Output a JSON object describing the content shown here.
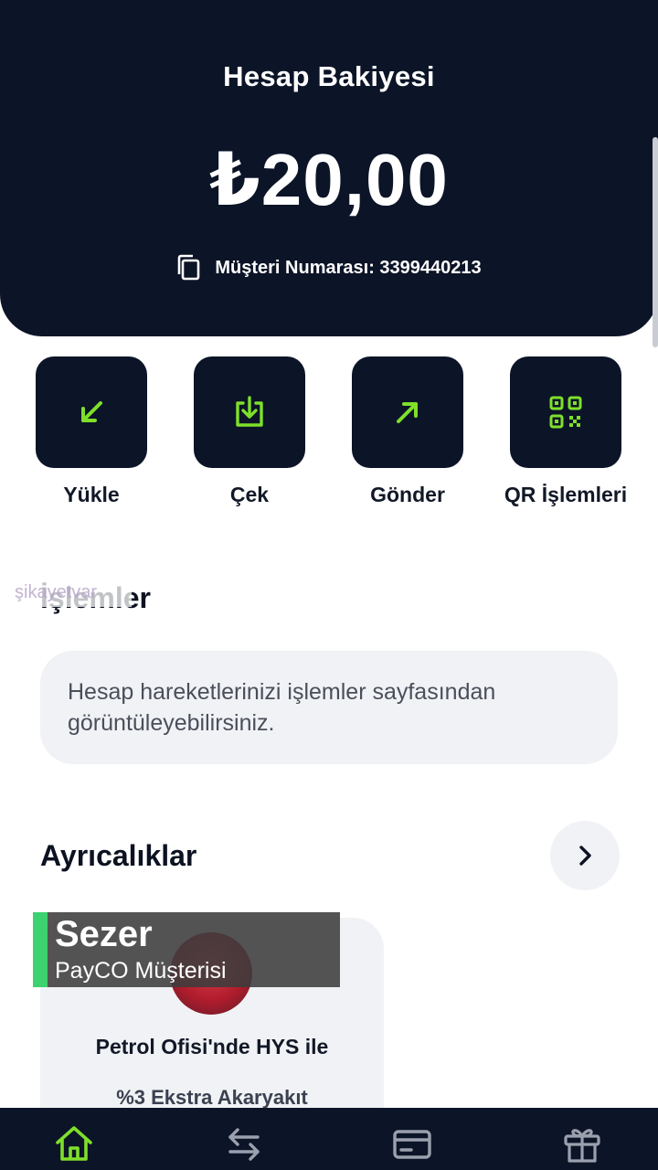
{
  "balance": {
    "title": "Hesap Bakiyesi",
    "amount": "₺20,00",
    "customer_number_label": "Müşteri Numarası: 3399440213"
  },
  "actions": [
    {
      "label": "Yükle",
      "icon": "arrow-down-left-icon"
    },
    {
      "label": "Çek",
      "icon": "download-tray-icon"
    },
    {
      "label": "Gönder",
      "icon": "arrow-up-right-icon"
    },
    {
      "label": "QR İşlemleri",
      "icon": "qr-code-icon"
    }
  ],
  "transactions": {
    "title": "İşlemler",
    "info": "Hesap hareketlerinizi işlemler sayfasından görüntüleyebilirsiniz."
  },
  "watermark": "şikayetvar",
  "privileges": {
    "title": "Ayrıcalıklar",
    "offer_title": "Petrol Ofisi'nde HYS ile",
    "offer_subtitle": "%3 Ekstra Akaryakıt"
  },
  "caption": {
    "name": "Sezer",
    "role": "PayCO Müşterisi"
  },
  "bottom_nav": [
    {
      "icon": "home-icon",
      "active": true
    },
    {
      "icon": "transfer-arrows-icon",
      "active": false
    },
    {
      "icon": "card-icon",
      "active": false
    },
    {
      "icon": "gift-icon",
      "active": false
    }
  ],
  "colors": {
    "navy": "#0c1427",
    "accent_green": "#7ee02a",
    "caption_bar": "#3bd26f",
    "card_bg": "#f1f2f5"
  }
}
